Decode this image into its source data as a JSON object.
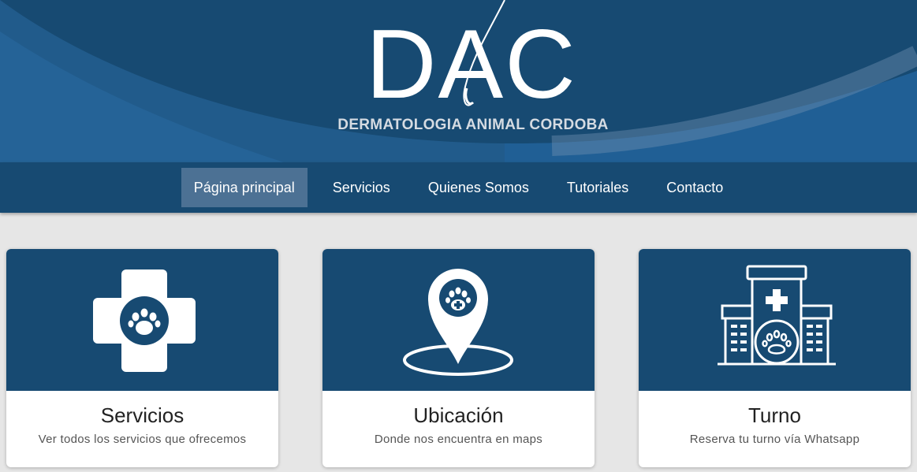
{
  "header": {
    "logo_letters": "DAC",
    "logo_subtitle": "DERMATOLOGIA ANIMAL CORDOBA"
  },
  "nav": {
    "items": [
      {
        "label": "Página principal",
        "active": true
      },
      {
        "label": "Servicios",
        "active": false
      },
      {
        "label": "Quienes Somos",
        "active": false
      },
      {
        "label": "Tutoriales",
        "active": false
      },
      {
        "label": "Contacto",
        "active": false
      }
    ]
  },
  "cards": [
    {
      "title": "Servicios",
      "description": "Ver todos los servicios que ofrecemos",
      "icon": "medical-cross-paw-icon"
    },
    {
      "title": "Ubicación",
      "description": "Donde nos encuentra en maps",
      "icon": "map-pin-paw-icon"
    },
    {
      "title": "Turno",
      "description": "Reserva tu turno vía Whatsapp",
      "icon": "vet-hospital-icon"
    }
  ],
  "colors": {
    "banner": "#184a72",
    "navbar": "#174a72",
    "nav_active": "#4c7194",
    "card_media": "#174a72",
    "page_bg": "#e6e6e6"
  }
}
